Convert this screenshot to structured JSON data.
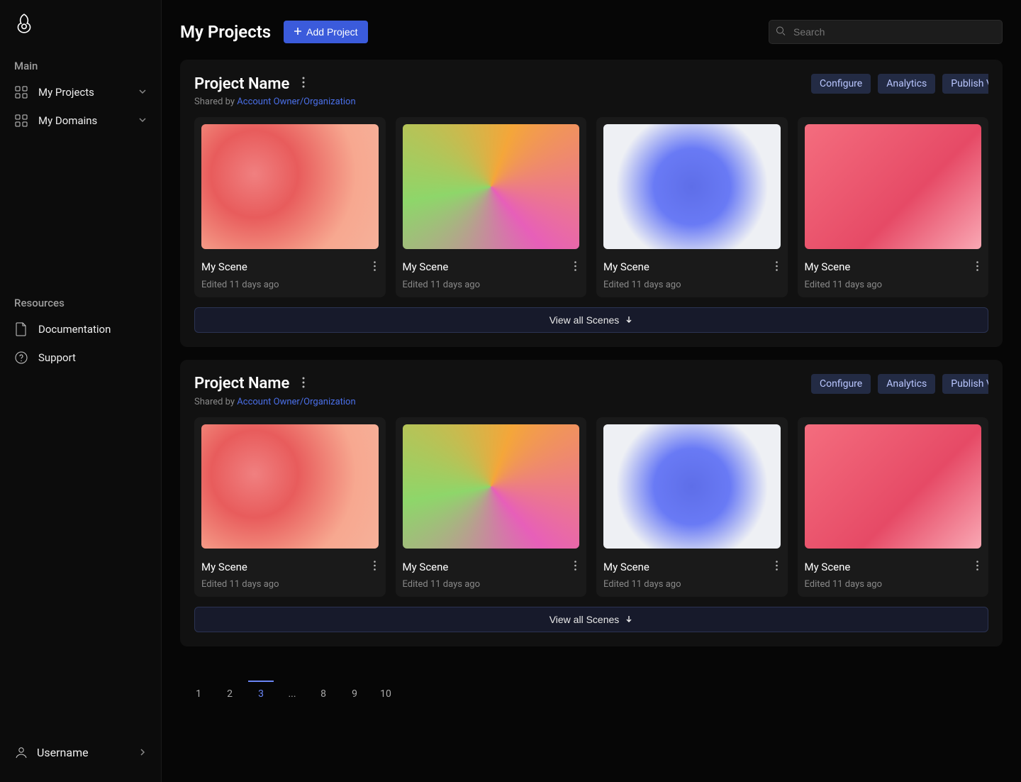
{
  "sidebar": {
    "sections": {
      "main_label": "Main",
      "resources_label": "Resources"
    },
    "items": {
      "projects": "My Projects",
      "domains": "My Domains",
      "documentation": "Documentation",
      "support": "Support"
    },
    "user": "Username"
  },
  "header": {
    "title": "My Projects",
    "add_button": "Add Project",
    "search_placeholder": "Search"
  },
  "projects": [
    {
      "title": "Project Name",
      "shared_prefix": "Shared by ",
      "shared_owner": "Account Owner/Organization",
      "actions": {
        "configure": "Configure",
        "analytics": "Analytics",
        "publish": "Publish Version"
      },
      "scenes": [
        {
          "name": "My Scene",
          "edited": "Edited 11 days ago"
        },
        {
          "name": "My Scene",
          "edited": "Edited 11 days ago"
        },
        {
          "name": "My Scene",
          "edited": "Edited 11 days ago"
        },
        {
          "name": "My Scene",
          "edited": "Edited 11 days ago"
        }
      ],
      "view_all": "View all Scenes"
    },
    {
      "title": "Project Name",
      "shared_prefix": "Shared by ",
      "shared_owner": "Account Owner/Organization",
      "actions": {
        "configure": "Configure",
        "analytics": "Analytics",
        "publish": "Publish Version"
      },
      "scenes": [
        {
          "name": "My Scene",
          "edited": "Edited 11 days ago"
        },
        {
          "name": "My Scene",
          "edited": "Edited 11 days ago"
        },
        {
          "name": "My Scene",
          "edited": "Edited 11 days ago"
        },
        {
          "name": "My Scene",
          "edited": "Edited 11 days ago"
        }
      ],
      "view_all": "View all Scenes"
    }
  ],
  "pagination": {
    "pages": [
      "1",
      "2",
      "3",
      "...",
      "8",
      "9",
      "10"
    ],
    "active_index": 2
  }
}
